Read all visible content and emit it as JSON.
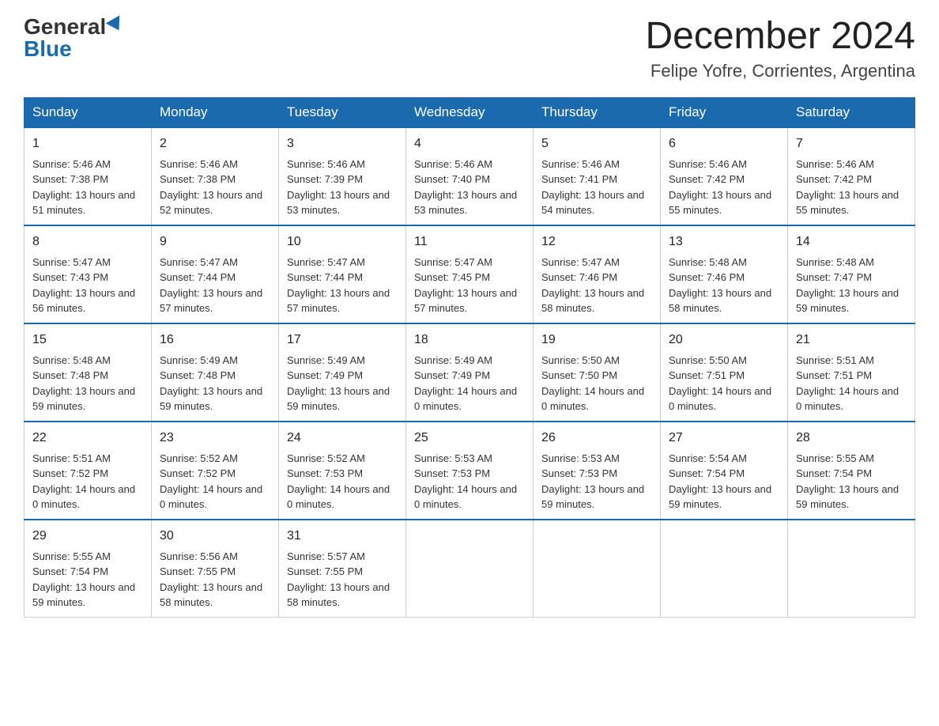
{
  "header": {
    "logo_general": "General",
    "logo_blue": "Blue",
    "month_title": "December 2024",
    "location": "Felipe Yofre, Corrientes, Argentina"
  },
  "days_of_week": [
    "Sunday",
    "Monday",
    "Tuesday",
    "Wednesday",
    "Thursday",
    "Friday",
    "Saturday"
  ],
  "weeks": [
    [
      {
        "day": "1",
        "sunrise": "5:46 AM",
        "sunset": "7:38 PM",
        "daylight": "13 hours and 51 minutes."
      },
      {
        "day": "2",
        "sunrise": "5:46 AM",
        "sunset": "7:38 PM",
        "daylight": "13 hours and 52 minutes."
      },
      {
        "day": "3",
        "sunrise": "5:46 AM",
        "sunset": "7:39 PM",
        "daylight": "13 hours and 53 minutes."
      },
      {
        "day": "4",
        "sunrise": "5:46 AM",
        "sunset": "7:40 PM",
        "daylight": "13 hours and 53 minutes."
      },
      {
        "day": "5",
        "sunrise": "5:46 AM",
        "sunset": "7:41 PM",
        "daylight": "13 hours and 54 minutes."
      },
      {
        "day": "6",
        "sunrise": "5:46 AM",
        "sunset": "7:42 PM",
        "daylight": "13 hours and 55 minutes."
      },
      {
        "day": "7",
        "sunrise": "5:46 AM",
        "sunset": "7:42 PM",
        "daylight": "13 hours and 55 minutes."
      }
    ],
    [
      {
        "day": "8",
        "sunrise": "5:47 AM",
        "sunset": "7:43 PM",
        "daylight": "13 hours and 56 minutes."
      },
      {
        "day": "9",
        "sunrise": "5:47 AM",
        "sunset": "7:44 PM",
        "daylight": "13 hours and 57 minutes."
      },
      {
        "day": "10",
        "sunrise": "5:47 AM",
        "sunset": "7:44 PM",
        "daylight": "13 hours and 57 minutes."
      },
      {
        "day": "11",
        "sunrise": "5:47 AM",
        "sunset": "7:45 PM",
        "daylight": "13 hours and 57 minutes."
      },
      {
        "day": "12",
        "sunrise": "5:47 AM",
        "sunset": "7:46 PM",
        "daylight": "13 hours and 58 minutes."
      },
      {
        "day": "13",
        "sunrise": "5:48 AM",
        "sunset": "7:46 PM",
        "daylight": "13 hours and 58 minutes."
      },
      {
        "day": "14",
        "sunrise": "5:48 AM",
        "sunset": "7:47 PM",
        "daylight": "13 hours and 59 minutes."
      }
    ],
    [
      {
        "day": "15",
        "sunrise": "5:48 AM",
        "sunset": "7:48 PM",
        "daylight": "13 hours and 59 minutes."
      },
      {
        "day": "16",
        "sunrise": "5:49 AM",
        "sunset": "7:48 PM",
        "daylight": "13 hours and 59 minutes."
      },
      {
        "day": "17",
        "sunrise": "5:49 AM",
        "sunset": "7:49 PM",
        "daylight": "13 hours and 59 minutes."
      },
      {
        "day": "18",
        "sunrise": "5:49 AM",
        "sunset": "7:49 PM",
        "daylight": "14 hours and 0 minutes."
      },
      {
        "day": "19",
        "sunrise": "5:50 AM",
        "sunset": "7:50 PM",
        "daylight": "14 hours and 0 minutes."
      },
      {
        "day": "20",
        "sunrise": "5:50 AM",
        "sunset": "7:51 PM",
        "daylight": "14 hours and 0 minutes."
      },
      {
        "day": "21",
        "sunrise": "5:51 AM",
        "sunset": "7:51 PM",
        "daylight": "14 hours and 0 minutes."
      }
    ],
    [
      {
        "day": "22",
        "sunrise": "5:51 AM",
        "sunset": "7:52 PM",
        "daylight": "14 hours and 0 minutes."
      },
      {
        "day": "23",
        "sunrise": "5:52 AM",
        "sunset": "7:52 PM",
        "daylight": "14 hours and 0 minutes."
      },
      {
        "day": "24",
        "sunrise": "5:52 AM",
        "sunset": "7:53 PM",
        "daylight": "14 hours and 0 minutes."
      },
      {
        "day": "25",
        "sunrise": "5:53 AM",
        "sunset": "7:53 PM",
        "daylight": "14 hours and 0 minutes."
      },
      {
        "day": "26",
        "sunrise": "5:53 AM",
        "sunset": "7:53 PM",
        "daylight": "13 hours and 59 minutes."
      },
      {
        "day": "27",
        "sunrise": "5:54 AM",
        "sunset": "7:54 PM",
        "daylight": "13 hours and 59 minutes."
      },
      {
        "day": "28",
        "sunrise": "5:55 AM",
        "sunset": "7:54 PM",
        "daylight": "13 hours and 59 minutes."
      }
    ],
    [
      {
        "day": "29",
        "sunrise": "5:55 AM",
        "sunset": "7:54 PM",
        "daylight": "13 hours and 59 minutes."
      },
      {
        "day": "30",
        "sunrise": "5:56 AM",
        "sunset": "7:55 PM",
        "daylight": "13 hours and 58 minutes."
      },
      {
        "day": "31",
        "sunrise": "5:57 AM",
        "sunset": "7:55 PM",
        "daylight": "13 hours and 58 minutes."
      },
      null,
      null,
      null,
      null
    ]
  ],
  "labels": {
    "sunrise": "Sunrise:",
    "sunset": "Sunset:",
    "daylight": "Daylight:"
  }
}
